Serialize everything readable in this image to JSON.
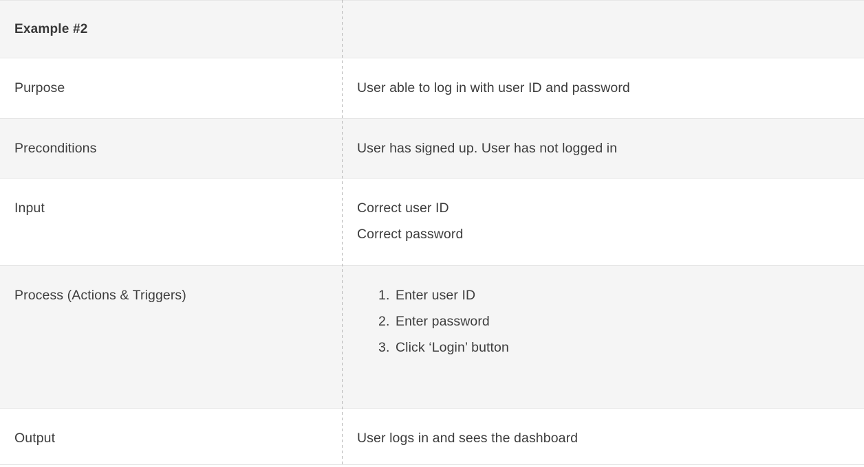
{
  "table": {
    "title": "Example #2",
    "rows": [
      {
        "label": "Example #2",
        "type": "header",
        "value": ""
      },
      {
        "label": "Purpose",
        "value": "User able to log in with user ID and password"
      },
      {
        "label": "Preconditions",
        "value": "User has signed up. User has not logged in"
      },
      {
        "label": "Input",
        "lines": [
          "Correct user ID",
          "Correct password"
        ]
      },
      {
        "label": "Process (Actions & Triggers)",
        "steps": [
          "Enter user ID",
          "Enter password",
          "Click ‘Login’ button"
        ]
      },
      {
        "label": "Output",
        "value": "User logs in and sees the dashboard"
      }
    ]
  },
  "colors": {
    "text": "#3d3d3d",
    "shaded_row": "#f5f5f5",
    "plain_row": "#ffffff",
    "border": "#e6e6e6",
    "divider": "#b8b8b8"
  }
}
